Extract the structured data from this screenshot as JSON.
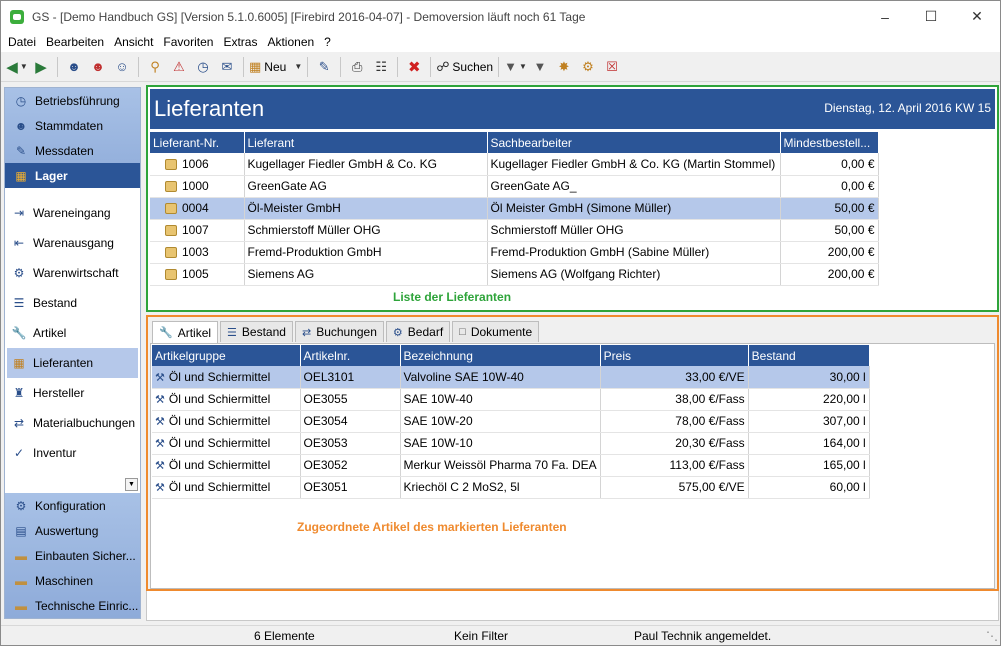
{
  "window": {
    "title": "GS - [Demo Handbuch GS]  [Version  5.1.0.6005]  [Firebird 2016-04-07]  - Demoversion läuft noch 61 Tage"
  },
  "menu": [
    "Datei",
    "Bearbeiten",
    "Ansicht",
    "Favoriten",
    "Extras",
    "Aktionen",
    "?"
  ],
  "toolbar": {
    "new_label": "Neu",
    "search_label": "Suchen"
  },
  "sidebar": {
    "top_groups": [
      {
        "label": "Betriebsführung",
        "icon": "clock-icon"
      },
      {
        "label": "Stammdaten",
        "icon": "people-icon"
      },
      {
        "label": "Messdaten",
        "icon": "pen-icon"
      },
      {
        "label": "Lager",
        "icon": "boxes-icon",
        "active": true
      }
    ],
    "sub_items": [
      {
        "label": "Wareneingang",
        "icon": "inbound-icon"
      },
      {
        "label": "Warenausgang",
        "icon": "outbound-icon"
      },
      {
        "label": "Warenwirtschaft",
        "icon": "goods-icon"
      },
      {
        "label": "Bestand",
        "icon": "stock-icon"
      },
      {
        "label": "Artikel",
        "icon": "wrench-icon"
      },
      {
        "label": "Lieferanten",
        "icon": "supplier-icon",
        "selected": true
      },
      {
        "label": "Hersteller",
        "icon": "factory-icon"
      },
      {
        "label": "Materialbuchungen",
        "icon": "booking-icon"
      },
      {
        "label": "Inventur",
        "icon": "inventory-icon"
      }
    ],
    "bottom_groups": [
      {
        "label": "Konfiguration",
        "icon": "gear-icon"
      },
      {
        "label": "Auswertung",
        "icon": "chart-icon"
      },
      {
        "label": "Einbauten Sicher...",
        "icon": "folder-icon"
      },
      {
        "label": "Maschinen",
        "icon": "folder-icon"
      },
      {
        "label": "Technische Einric...",
        "icon": "folder-icon"
      }
    ]
  },
  "header": {
    "title": "Lieferanten",
    "date": "Dienstag, 12. April 2016  KW 15"
  },
  "suppliers": {
    "columns": [
      "Lieferant-Nr.",
      "Lieferant",
      "Sachbearbeiter",
      "Mindestbestell..."
    ],
    "rows": [
      {
        "nr": "1006",
        "name": "Kugellager Fiedler GmbH & Co. KG",
        "contact": "Kugellager Fiedler GmbH & Co. KG   (Martin Stommel)",
        "min": "0,00 €"
      },
      {
        "nr": "1000",
        "name": "GreenGate AG",
        "contact": "GreenGate AG_",
        "min": "0,00 €"
      },
      {
        "nr": "0004",
        "name": "Öl-Meister GmbH",
        "contact": "Öl Meister GmbH  (Simone Müller)",
        "min": "50,00 €",
        "selected": true
      },
      {
        "nr": "1007",
        "name": "Schmierstoff Müller OHG",
        "contact": "Schmierstoff Müller OHG",
        "min": "50,00 €"
      },
      {
        "nr": "1003",
        "name": "Fremd-Produktion GmbH",
        "contact": "Fremd-Produktion GmbH  (Sabine Müller)",
        "min": "200,00 €"
      },
      {
        "nr": "1005",
        "name": "Siemens AG",
        "contact": "Siemens AG    (Wolfgang Richter)",
        "min": "200,00 €"
      }
    ],
    "caption": "Liste der Lieferanten"
  },
  "tabs": [
    {
      "label": "Artikel",
      "icon": "wrench-icon",
      "active": true
    },
    {
      "label": "Bestand",
      "icon": "stock-icon"
    },
    {
      "label": "Buchungen",
      "icon": "booking-icon"
    },
    {
      "label": "Bedarf",
      "icon": "demand-icon"
    },
    {
      "label": "Dokumente",
      "icon": "document-icon"
    }
  ],
  "articles": {
    "columns": [
      "Artikelgruppe",
      "Artikelnr.",
      "Bezeichnung",
      "Preis",
      "Bestand"
    ],
    "rows": [
      {
        "group": "Öl und Schiermittel",
        "nr": "OEL3101",
        "name": "Valvoline SAE 10W-40",
        "price": "33,00 €/VE",
        "stock": "30,00 l",
        "selected": true
      },
      {
        "group": "Öl und Schiermittel",
        "nr": "OE3055",
        "name": "SAE 10W-40",
        "price": "38,00 €/Fass",
        "stock": "220,00 l"
      },
      {
        "group": "Öl und Schiermittel",
        "nr": "OE3054",
        "name": "SAE 10W-20",
        "price": "78,00 €/Fass",
        "stock": "307,00 l"
      },
      {
        "group": "Öl und Schiermittel",
        "nr": "OE3053",
        "name": "SAE 10W-10",
        "price": "20,30 €/Fass",
        "stock": "164,00 l"
      },
      {
        "group": "Öl und Schiermittel",
        "nr": "OE3052",
        "name": "Merkur Weissöl Pharma 70 Fa. DEA",
        "price": "113,00 €/Fass",
        "stock": "165,00 l"
      },
      {
        "group": "Öl und Schiermittel",
        "nr": "OE3051",
        "name": "Kriechöl C 2 MoS2, 5l",
        "price": "575,00 €/VE",
        "stock": "60,00 l"
      }
    ],
    "caption": "Zugeordnete Artikel des markierten Lieferanten"
  },
  "status": {
    "count": "6 Elemente",
    "filter": "Kein Filter",
    "user": "Paul Technik angemeldet."
  }
}
